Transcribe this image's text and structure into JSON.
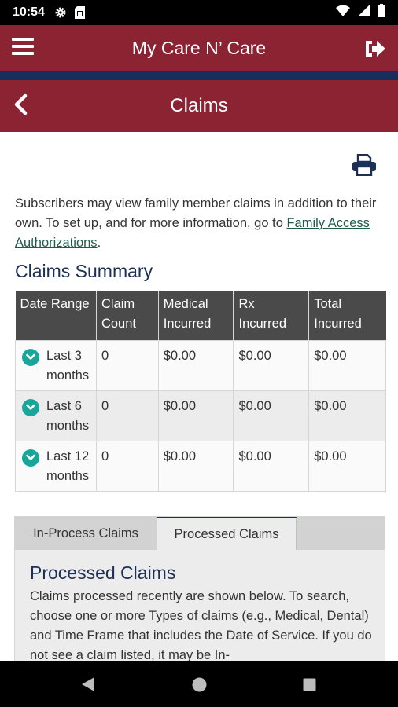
{
  "status_bar": {
    "time": "10:54",
    "icons": [
      "gear-icon",
      "sim-card-icon",
      "wifi-icon",
      "cellular-signal-icon",
      "battery-icon"
    ]
  },
  "app_bar": {
    "title": "My Care N’ Care",
    "menu_icon": "hamburger-menu-icon",
    "logout_icon": "sign-out-icon",
    "color": "#8b2332",
    "stripe_color": "#15305a"
  },
  "page_bar": {
    "title": "Claims",
    "back_icon": "chevron-left-icon"
  },
  "print_icon": "printer-icon",
  "intro": {
    "text": "Subscribers may view family member claims in addition to their own. To set up, and for more information, go to ",
    "link": "Family Access Authorizations",
    "end": "."
  },
  "summary": {
    "title": "Claims Summary",
    "headers": [
      "Date Range",
      "Claim Count",
      "Medical Incurred",
      "Rx Incurred",
      "Total Incurred"
    ],
    "rows": [
      {
        "range": "Last 3 months",
        "count": "0",
        "medical": "$0.00",
        "rx": "$0.00",
        "total": "$0.00"
      },
      {
        "range": "Last 6 months",
        "count": "0",
        "medical": "$0.00",
        "rx": "$0.00",
        "total": "$0.00"
      },
      {
        "range": "Last 12 months",
        "count": "0",
        "medical": "$0.00",
        "rx": "$0.00",
        "total": "$0.00"
      }
    ],
    "accent": "#1aa59a"
  },
  "tabs": {
    "items": [
      "In-Process Claims",
      "Processed Claims"
    ],
    "active": "Processed Claims"
  },
  "processed": {
    "title": "Processed Claims",
    "text": "Claims processed recently are shown below. To search, choose one or more Types of claims (e.g., Medical, Dental) and Time Frame that includes the Date of Service. If you do not see a claim listed, it may be In-"
  },
  "nav_bar": {
    "icons": [
      "back-triangle-icon",
      "home-circle-icon",
      "recents-square-icon"
    ]
  }
}
